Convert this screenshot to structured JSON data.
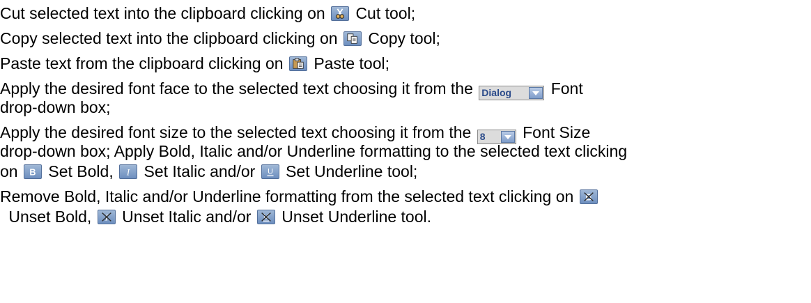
{
  "lines": {
    "cut": {
      "before": "Cut selected text into the clipboard clicking on",
      "after": "Cut tool;"
    },
    "copy": {
      "before": "Copy selected text into the clipboard clicking on",
      "after": "Copy tool;"
    },
    "paste": {
      "before": "Paste text from the clipboard clicking on",
      "after": "Paste tool;"
    },
    "font_1": {
      "before": "Apply the desired font face to the selected text choosing it from the",
      "after": "Font"
    },
    "font_2": "drop-down box;",
    "size_1": {
      "before": "Apply the desired font size to the selected text choosing it from the",
      "after": "Font Size"
    },
    "size_2": "drop-down box; Apply Bold, Italic and/or Underline formatting to the selected text clicking",
    "set_3": {
      "on": "on",
      "bold": "Set Bold,",
      "italic": "Set Italic and/or",
      "underline": "Set Underline tool;"
    },
    "remove_1": "Remove Bold, Italic and/or Underline formatting from the selected text clicking on",
    "remove_2": {
      "bold": "Unset Bold,",
      "italic": "Unset Italic and/or",
      "underline": "Unset Underline tool."
    }
  },
  "controls": {
    "font_value": "Dialog",
    "size_value": "8"
  },
  "icons": {
    "cut": "scissors-icon",
    "copy": "copy-icon",
    "paste": "paste-icon",
    "bold": "bold-icon",
    "italic": "italic-icon",
    "underline": "underline-icon",
    "unset_bold": "unset-bold-icon",
    "unset_italic": "unset-italic-icon",
    "unset_underline": "unset-underline-icon",
    "dropdown": "chevron-down-icon"
  },
  "colors": {
    "text": "#000000",
    "icon_blue": "#6d8fbf",
    "dropdown_text": "#2a4a8a"
  }
}
